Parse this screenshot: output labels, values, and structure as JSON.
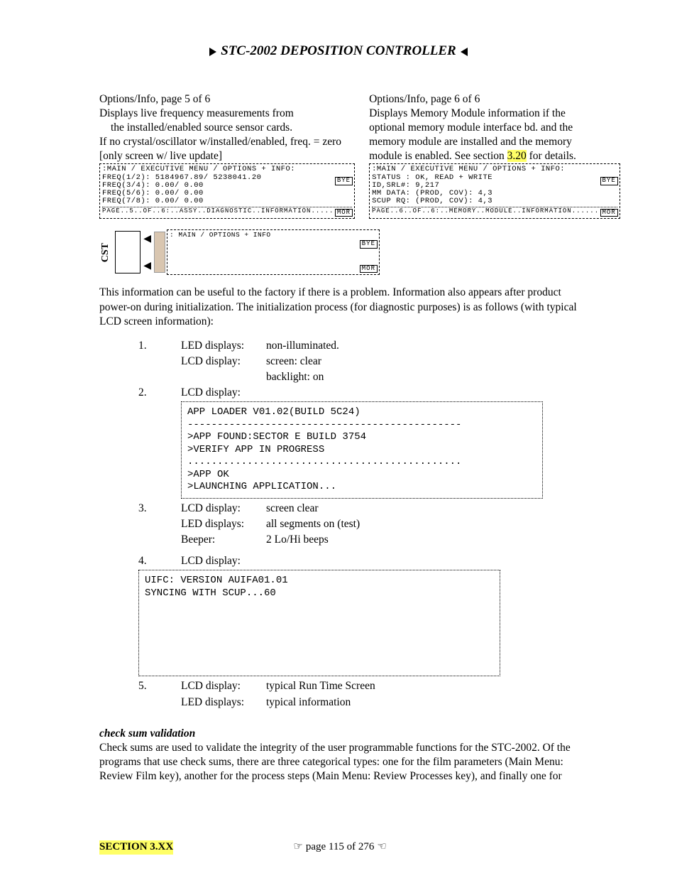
{
  "title": "STC-2002  DEPOSITION CONTROLLER",
  "left": {
    "h": "Options/Info, page 5 of 6",
    "l1": "Displays live frequency measurements from",
    "l2": "the installed/enabled source sensor cards.",
    "l3": "If no crystal/oscillator w/installed/enabled, freq. = zero",
    "l4": "[only screen w/ live update]",
    "lcd_header": ":MAIN / EXECUTIVE MENU / OPTIONS + INFO:",
    "lcd_rows": [
      "FREQ(1/2):  5184967.89/  5238041.20",
      "FREQ(3/4):        0.00/        0.00",
      "FREQ(5/6):        0.00/        0.00",
      "FREQ(7/8):        0.00/        0.00"
    ],
    "lcd_footer": "PAGE..5..OF..6:..ASSY..DIAGNOSTIC..INFORMATION.........",
    "bye": "BYE",
    "mor": "MOR"
  },
  "right": {
    "h": "Options/Info, page 6 of 6",
    "l1": "Displays Memory Module information if the",
    "l2": "optional memory module interface bd. and the",
    "l3": "memory module are installed and the memory",
    "l4a": "module is enabled. See section ",
    "l4b": "3.20",
    "l4c": " for details.",
    "lcd_header": ":MAIN / EXECUTIVE MENU / OPTIONS + INFO:",
    "lcd_rows": [
      "STATUS :  OK, READ + WRITE",
      "ID,SRL#:  9,217",
      "MM DATA:  (PROD, COV): 4,3",
      "SCUP RQ:  (PROD, COV): 4,3"
    ],
    "lcd_footer": "PAGE..6..OF..6:..MEMORY..MODULE..INFORMATION..........",
    "bye": "BYE",
    "mor": "MOR"
  },
  "cst": {
    "label": "CST",
    "lcd_header": ": MAIN / OPTIONS + INFO",
    "bye": "BYE",
    "mor": "MOR"
  },
  "para1": "This information can be useful to the factory if there is a problem.  Information also appears after product power-on during initialization.  The initialization process (for diagnostic purposes) is as follows (with typical LCD screen information):",
  "init": {
    "s1": {
      "n": "1.",
      "a": "LED displays:",
      "av": "non-illuminated.",
      "b": "LCD display:",
      "bv": "screen: clear",
      "cv": "backlight: on"
    },
    "s2": {
      "n": "2.",
      "a": "LCD display:",
      "mono": "APP LOADER V01.02(BUILD 5C24)\n----------------------------------------------\n>APP FOUND:SECTOR E BUILD 3754\n>VERIFY APP IN PROGRESS\n..............................................\n>APP OK\n>LAUNCHING APPLICATION..."
    },
    "s3": {
      "n": "3.",
      "a": "LCD display:",
      "av": "screen clear",
      "b": "LED displays:",
      "bv": "all segments on (test)",
      "c": "Beeper:",
      "cv": "2 Lo/Hi beeps"
    },
    "s4": {
      "n": "4.",
      "a": "LCD display:",
      "mono": "UIFC: VERSION AUIFA01.01\nSYNCING WITH SCUP...60\n\n\n\n\n"
    },
    "s5": {
      "n": "5.",
      "a": "LCD display:",
      "av": "typical Run Time Screen",
      "b": "LED displays:",
      "bv": "typical information"
    }
  },
  "checksum": {
    "h": "check sum validation",
    "p": "Check sums are used to validate the integrity of the user programmable functions for the STC-2002. Of the programs that use check sums, there are three categorical types: one for the film parameters (Main Menu: Review Film key), another for the process steps (Main Menu: Review Processes key), and finally one for"
  },
  "footer": {
    "section": "SECTION 3.XX",
    "page": "page 115 of 276"
  }
}
